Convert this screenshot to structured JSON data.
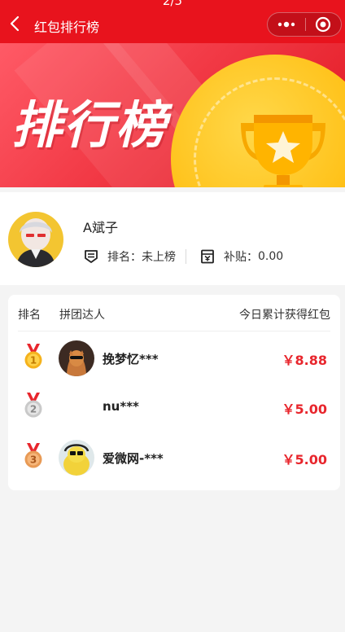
{
  "status_bar": {
    "text": "2/5"
  },
  "nav": {
    "title": "红包排行榜",
    "back_icon": "chevron-left-icon",
    "menu_icon": "more-dots-icon",
    "close_icon": "target-circle-icon"
  },
  "banner": {
    "title": "排行榜",
    "icon": "trophy-star-icon"
  },
  "profile": {
    "name": "A斌子",
    "rank_label": "排名：",
    "rank_value": "未上榜",
    "subsidy_label": "补贴：",
    "subsidy_value": "0.00",
    "rank_icon": "rank-list-icon",
    "subsidy_icon": "subsidy-icon"
  },
  "ranking": {
    "columns": {
      "rank": "排名",
      "user": "拼团达人",
      "amount": "今日累计获得红包"
    },
    "rows": [
      {
        "rank": "1",
        "name": "挽梦忆***",
        "amount": "￥8.88",
        "medal_color": "#f5b21c"
      },
      {
        "rank": "2",
        "name": "nu***",
        "amount": "￥5.00",
        "medal_color": "#c9c9c9"
      },
      {
        "rank": "3",
        "name": "爱微网-***",
        "amount": "￥5.00",
        "medal_color": "#e89a55"
      }
    ]
  },
  "colors": {
    "brand_red": "#e8131d",
    "amount_red": "#e8262d",
    "gold": "#ffc21a"
  }
}
